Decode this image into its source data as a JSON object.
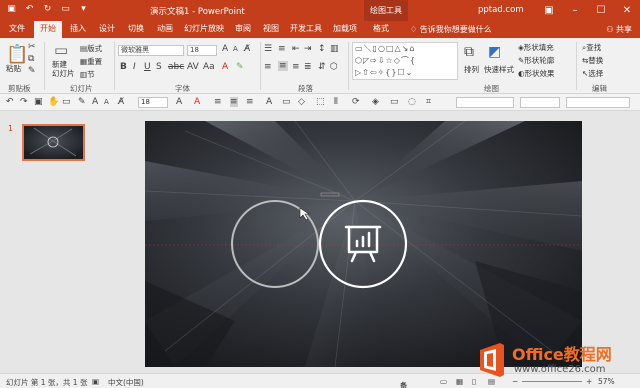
{
  "titlebar": {
    "title": "演示文稿1 - PowerPoint",
    "context_tab": "绘图工具",
    "account": "pptad.com",
    "qat_icons": [
      "save-icon",
      "undo-icon",
      "redo-icon",
      "start-slideshow-icon",
      "customize-icon"
    ],
    "window_buttons": [
      "minimize-icon",
      "restore-icon",
      "close-icon"
    ]
  },
  "tabs": {
    "items": [
      "文件",
      "开始",
      "插入",
      "设计",
      "切换",
      "动画",
      "幻灯片放映",
      "审阅",
      "视图",
      "开发工具",
      "加载项",
      "格式"
    ],
    "active": "开始",
    "tell_me": "告诉我你想要做什么",
    "share": "共享"
  },
  "ribbon": {
    "clipboard": {
      "paste": "粘贴",
      "label": "剪贴板"
    },
    "slides": {
      "new_slide": "新建\n幻灯片",
      "layout": "版式",
      "reset": "重置",
      "section": "节",
      "label": "幻灯片"
    },
    "font": {
      "name": "微软雅黑",
      "size": "18",
      "label": "字体"
    },
    "paragraph": {
      "label": "段落"
    },
    "drawing": {
      "arrange": "排列",
      "quick_styles": "快速样式",
      "fill": "形状填充",
      "outline": "形状轮廓",
      "effects": "形状效果",
      "label": "绘图"
    },
    "editing": {
      "find": "查找",
      "replace": "替换",
      "select": "选择",
      "label": "编辑"
    }
  },
  "toolbar2": {
    "font_size": "18"
  },
  "thumbs": {
    "number": "1"
  },
  "status": {
    "slide_info": "幻灯片 第 1 张，共 1 张",
    "language": "中文(中国)",
    "notes": "备注",
    "zoom": "57%"
  },
  "watermark": {
    "site": "Office教程网",
    "url": "www.office26.com"
  }
}
